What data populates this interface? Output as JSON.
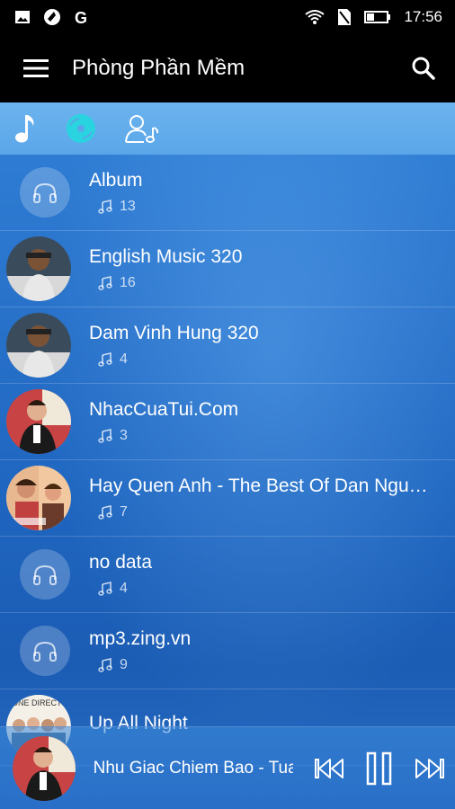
{
  "status": {
    "time": "17:56",
    "icons": [
      "image-icon",
      "globe-icon",
      "g-icon",
      "wifi-icon",
      "sim-icon",
      "battery-icon"
    ]
  },
  "app": {
    "title": "Phòng Phần Mềm",
    "accent": "#000000"
  },
  "tabs": [
    {
      "name": "songs-tab-icon",
      "active": false
    },
    {
      "name": "albums-tab-icon",
      "active": true
    },
    {
      "name": "artists-tab-icon",
      "active": false
    }
  ],
  "albums": [
    {
      "title": "Album",
      "count": "13",
      "art": "placeholder"
    },
    {
      "title": "English Music 320",
      "count": "16",
      "art": "photo-man-a"
    },
    {
      "title": "Dam Vinh Hung 320",
      "count": "4",
      "art": "photo-man-a"
    },
    {
      "title": "NhacCuaTui.Com",
      "count": "3",
      "art": "photo-man-b"
    },
    {
      "title": "Hay Quen Anh - The Best Of Dan Nguyen",
      "count": "7",
      "art": "photo-cover-c"
    },
    {
      "title": "no data",
      "count": "4",
      "art": "placeholder"
    },
    {
      "title": "mp3.zing.vn",
      "count": "9",
      "art": "placeholder"
    },
    {
      "title": "Up All Night",
      "count": "",
      "art": "photo-cover-d"
    }
  ],
  "player": {
    "title": "Nhu Giac Chiem Bao - Tuan Hung",
    "controls": [
      "previous-button",
      "pause-button",
      "next-button"
    ]
  },
  "colors": {
    "tabbar": "#5aa6e8",
    "active_tab": "#2ad3e0",
    "list_bg": "#2a74cc"
  }
}
